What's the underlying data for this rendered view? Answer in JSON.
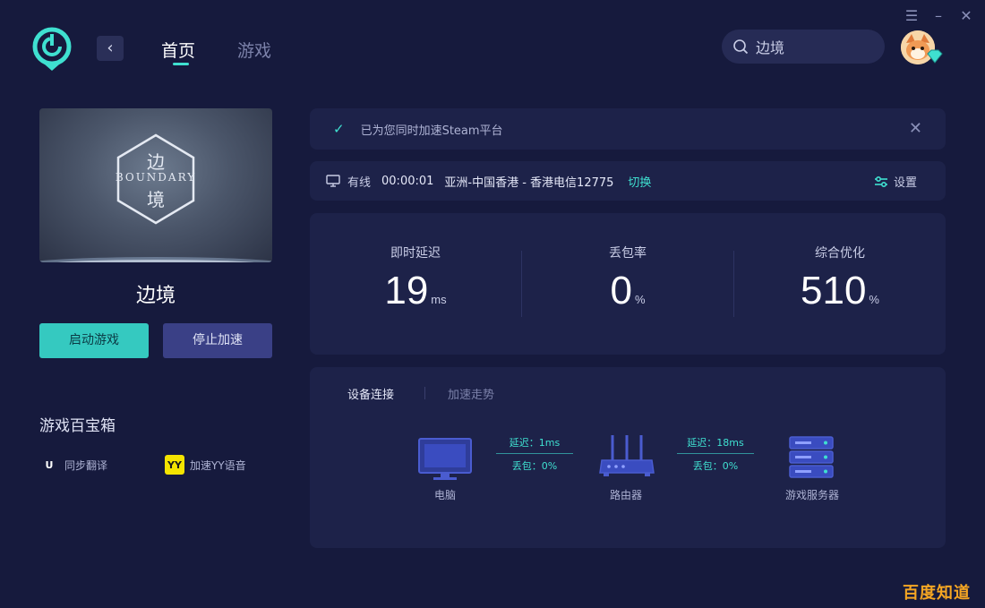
{
  "header": {
    "nav_home": "首页",
    "nav_games": "游戏",
    "search_value": "边境"
  },
  "game": {
    "banner_char_top": "边",
    "banner_text": "BOUNDARY",
    "banner_char_bottom": "境",
    "title": "边境",
    "start_label": "启动游戏",
    "stop_label": "停止加速"
  },
  "toolbox": {
    "title": "游戏百宝箱",
    "items": [
      {
        "icon_text": "U",
        "label": "同步翻译"
      },
      {
        "icon_text": "YY",
        "label": "加速YY语音"
      }
    ]
  },
  "notice": {
    "text": "已为您同时加速Steam平台"
  },
  "status": {
    "online": "有线",
    "time": "00:00:01",
    "route": "亚洲-中国香港 - 香港电信12775",
    "switch": "切换",
    "settings": "设置"
  },
  "stats": [
    {
      "label": "即时延迟",
      "value": "19",
      "unit": "ms"
    },
    {
      "label": "丢包率",
      "value": "0",
      "unit": "%"
    },
    {
      "label": "综合优化",
      "value": "510",
      "unit": "%"
    }
  ],
  "device": {
    "tab_active": "设备连接",
    "tab_inactive": "加速走势",
    "nodes": [
      "电脑",
      "路由器",
      "游戏服务器"
    ],
    "links": [
      {
        "latency": "延迟：1ms",
        "loss": "丢包：0%"
      },
      {
        "latency": "延迟：18ms",
        "loss": "丢包：0%"
      }
    ]
  },
  "watermark": "百度知道",
  "colors": {
    "background": "#161a3d",
    "panel": "#1d2249",
    "accent": "#3fe0d0",
    "stop_button": "#3a4086"
  }
}
